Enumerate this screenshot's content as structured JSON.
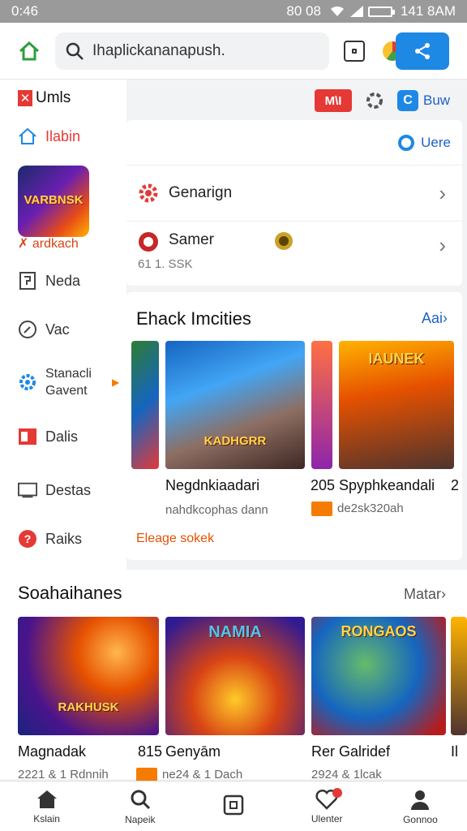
{
  "status": {
    "time": "0:46",
    "right_text": "80 08",
    "clock": "141 8AM"
  },
  "search": {
    "value": "Ihaplickananapush."
  },
  "sidebar": {
    "logo": "Umls",
    "items": [
      {
        "label": "Ilabin"
      },
      {
        "label": "Neda"
      },
      {
        "label": "Vac"
      },
      {
        "label": "Stanacli Gavent"
      },
      {
        "label": "Dalis"
      },
      {
        "label": "Destas"
      },
      {
        "label": "Raiks"
      }
    ],
    "game_tile": {
      "art_text": "VARBNSK",
      "label": "ardkach"
    }
  },
  "toprow": {
    "badge": "M\\I",
    "button": "Buw"
  },
  "card1": {
    "header_link": "Uere",
    "rows": [
      {
        "label": "Genarign"
      },
      {
        "label": "Samer",
        "sub": "61 1. SSK"
      }
    ]
  },
  "section1": {
    "title": "Ehack Imcities",
    "more": "Aai",
    "games": [
      {
        "art": "KADHGRR",
        "title": "Negdnkiaadari",
        "sub": "nahdkcophas dann"
      },
      {
        "art": "IAUNEK",
        "title": "Spyphkeandali",
        "sub": "de2sk320ah"
      }
    ],
    "edge_labels": [
      "205",
      "2"
    ],
    "link": "Eleage sokek"
  },
  "section2": {
    "title": "Soahaihanes",
    "more": "Matar",
    "games": [
      {
        "art": "RAKHUSK",
        "title": "Magnadak",
        "sub": "2221 & 1 Rdnnih"
      },
      {
        "art": "NAMIA",
        "title": "Genyām",
        "sub": "ne24 & 1 Dach"
      },
      {
        "art": "RONGAOS",
        "title": "Rer Galridef",
        "sub": "2924 & 1lcak"
      }
    ],
    "edge_labels": [
      "815",
      "Il"
    ]
  },
  "bottomnav": [
    {
      "label": "Kslain",
      "icon": "home-icon"
    },
    {
      "label": "Napeik",
      "icon": "search-icon"
    },
    {
      "label": "",
      "icon": "square-icon"
    },
    {
      "label": "Ulenter",
      "icon": "heart-icon"
    },
    {
      "label": "Gonnoo",
      "icon": "profile-icon"
    }
  ]
}
